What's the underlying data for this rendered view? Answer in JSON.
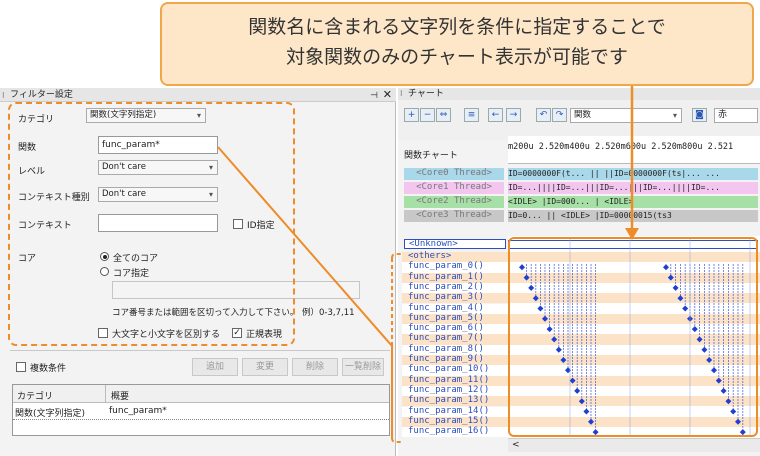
{
  "callout": {
    "line1": "関数名に含まれる文字列を条件に指定することで",
    "line2": "対象関数のみのチャート表示が可能です"
  },
  "filter_panel": {
    "title": "フィルター設定",
    "pin": "⊣",
    "close": "✕",
    "category_label": "カテゴリ",
    "category_value": "関数(文字列指定)",
    "function_label": "関数",
    "function_value": "func_param*",
    "level_label": "レベル",
    "level_value": "Don't care",
    "context_type_label": "コンテキスト種別",
    "context_type_value": "Don't care",
    "context_label": "コンテキスト",
    "context_value": "",
    "id_label": "ID指定",
    "core_label": "コア",
    "core_all": "全てのコア",
    "core_specify": "コア指定",
    "core_hint": "コア番号または範囲を区切って入力して下さい。",
    "core_example": "例）0-3,7,11",
    "case_label": "大文字と小文字を区別する",
    "regex_label": "正規表現",
    "multi_label": "複数条件",
    "add_label": "追加",
    "change_label": "変更",
    "delete_label": "削除",
    "delete_all_label": "一覧削除",
    "table": {
      "col1": "カテゴリ",
      "col2": "概要",
      "row1_col1": "関数(文字列指定)",
      "row1_col2": "func_param*"
    }
  },
  "chart_panel": {
    "title": "チャート",
    "func_combo": "関数",
    "red_label": "赤",
    "func_chart_label": "関数チャート",
    "time_axis": "m200u   2.520m400u  2.520m600u  2.520m800u  2.521",
    "threads": [
      {
        "label": "<Core0 Thread>",
        "data": "ID=0000000F(t...  ||  ||ID=0000000F(ts|...  ...",
        "bg": "#a9d8ea"
      },
      {
        "label": "<Core1 Thread>",
        "data": "ID=...||||ID=...|||ID=...|||ID=...||||ID=...",
        "bg": "#f3c6ef"
      },
      {
        "label": "<Core2 Thread>",
        "data": " <IDLE>  |ID=000...  |     <IDLE>    ",
        "bg": "#a6e0a6"
      },
      {
        "label": "<Core3 Thread>",
        "data": "ID=0...  ||  <IDLE>  |ID=00000015(ts3",
        "bg": "#c8c8c8"
      }
    ],
    "unknown_label": "<Unknown>",
    "others_label": "<others>",
    "functions": [
      "func_param_0()",
      "func_param_1()",
      "func_param_2()",
      "func_param_3()",
      "func_param_4()",
      "func_param_5()",
      "func_param_6()",
      "func_param_7()",
      "func_param_8()",
      "func_param_9()",
      "func_param_10()",
      "func_param_11()",
      "func_param_12()",
      "func_param_13()",
      "func_param_14()",
      "func_param_15()",
      "func_param_16()"
    ],
    "colors": {
      "accent": "#ee8c2a",
      "mark": "#1f3fd0",
      "stripe": "#fce2c7"
    }
  }
}
